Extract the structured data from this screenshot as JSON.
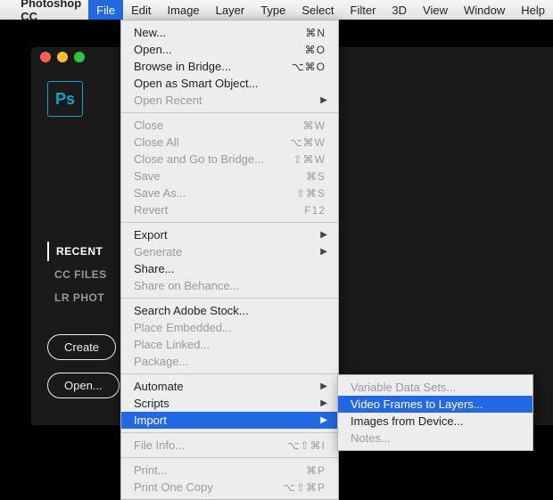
{
  "menubar": {
    "app": "Photoshop CC",
    "items": [
      "File",
      "Edit",
      "Image",
      "Layer",
      "Type",
      "Select",
      "Filter",
      "3D",
      "View",
      "Window",
      "Help"
    ],
    "active_index": 0
  },
  "ps_start": {
    "badge": "Ps",
    "tabs": [
      "RECENT",
      "CC FILES",
      "LR PHOT"
    ],
    "selected_tab": 0,
    "buttons": {
      "create": "Create",
      "open": "Open..."
    }
  },
  "file_menu": {
    "groups": [
      [
        {
          "label": "New...",
          "shortcut": "⌘N"
        },
        {
          "label": "Open...",
          "shortcut": "⌘O"
        },
        {
          "label": "Browse in Bridge...",
          "shortcut": "⌥⌘O"
        },
        {
          "label": "Open as Smart Object..."
        },
        {
          "label": "Open Recent",
          "submenu": true,
          "disabled": true
        }
      ],
      [
        {
          "label": "Close",
          "shortcut": "⌘W",
          "disabled": true
        },
        {
          "label": "Close All",
          "shortcut": "⌥⌘W",
          "disabled": true
        },
        {
          "label": "Close and Go to Bridge...",
          "shortcut": "⇧⌘W",
          "disabled": true
        },
        {
          "label": "Save",
          "shortcut": "⌘S",
          "disabled": true
        },
        {
          "label": "Save As...",
          "shortcut": "⇧⌘S",
          "disabled": true
        },
        {
          "label": "Revert",
          "shortcut": "F12",
          "disabled": true
        }
      ],
      [
        {
          "label": "Export",
          "submenu": true
        },
        {
          "label": "Generate",
          "submenu": true,
          "disabled": true
        },
        {
          "label": "Share..."
        },
        {
          "label": "Share on Behance...",
          "disabled": true
        }
      ],
      [
        {
          "label": "Search Adobe Stock..."
        },
        {
          "label": "Place Embedded...",
          "disabled": true
        },
        {
          "label": "Place Linked...",
          "disabled": true
        },
        {
          "label": "Package...",
          "disabled": true
        }
      ],
      [
        {
          "label": "Automate",
          "submenu": true
        },
        {
          "label": "Scripts",
          "submenu": true
        },
        {
          "label": "Import",
          "submenu": true,
          "highlight": true
        }
      ],
      [
        {
          "label": "File Info...",
          "shortcut": "⌥⇧⌘I",
          "disabled": true
        }
      ],
      [
        {
          "label": "Print...",
          "shortcut": "⌘P",
          "disabled": true
        },
        {
          "label": "Print One Copy",
          "shortcut": "⌥⇧⌘P",
          "disabled": true
        }
      ]
    ]
  },
  "import_submenu": [
    {
      "label": "Variable Data Sets...",
      "disabled": true
    },
    {
      "label": "Video Frames to Layers...",
      "highlight": true
    },
    {
      "label": "Images from Device..."
    },
    {
      "label": "Notes...",
      "disabled": true
    }
  ]
}
